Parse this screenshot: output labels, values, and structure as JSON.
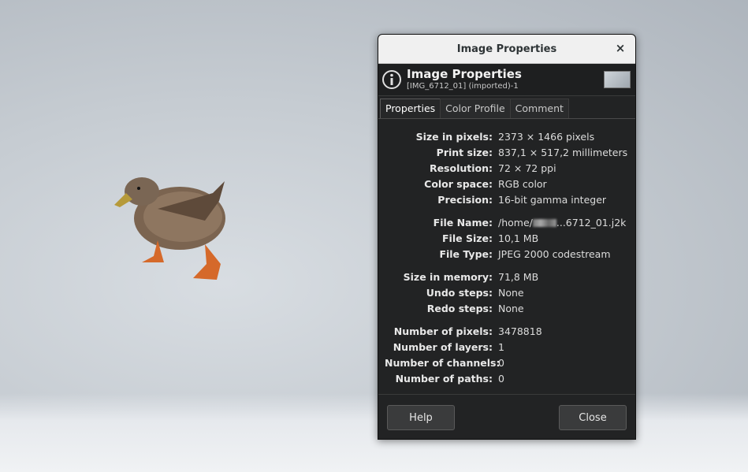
{
  "window": {
    "title": "Image Properties",
    "close_symbol": "×"
  },
  "header": {
    "title": "Image Properties",
    "subtitle": "[IMG_6712_01] (imported)-1"
  },
  "tabs": [
    {
      "label": "Properties",
      "active": true
    },
    {
      "label": "Color Profile",
      "active": false
    },
    {
      "label": "Comment",
      "active": false
    }
  ],
  "properties": {
    "size_in_pixels": {
      "label": "Size in pixels:",
      "value": "2373 × 1466 pixels"
    },
    "print_size": {
      "label": "Print size:",
      "value": "837,1 × 517,2 millimeters"
    },
    "resolution": {
      "label": "Resolution:",
      "value": "72 × 72 ppi"
    },
    "color_space": {
      "label": "Color space:",
      "value": "RGB color"
    },
    "precision": {
      "label": "Precision:",
      "value": "16-bit gamma integer"
    },
    "file_name": {
      "label": "File Name:",
      "value_prefix": "/home/",
      "value_suffix": "...6712_01.j2k"
    },
    "file_size": {
      "label": "File Size:",
      "value": "10,1 MB"
    },
    "file_type": {
      "label": "File Type:",
      "value": "JPEG 2000 codestream"
    },
    "size_in_memory": {
      "label": "Size in memory:",
      "value": "71,8 MB"
    },
    "undo_steps": {
      "label": "Undo steps:",
      "value": "None"
    },
    "redo_steps": {
      "label": "Redo steps:",
      "value": "None"
    },
    "number_of_pixels": {
      "label": "Number of pixels:",
      "value": "3478818"
    },
    "number_of_layers": {
      "label": "Number of layers:",
      "value": "1"
    },
    "number_of_channels": {
      "label": "Number of channels:",
      "value": "0"
    },
    "number_of_paths": {
      "label": "Number of paths:",
      "value": "0"
    }
  },
  "buttons": {
    "help": "Help",
    "close": "Close"
  },
  "icons": {
    "info": "info-icon",
    "close": "close-icon",
    "thumbnail": "image-thumbnail"
  }
}
